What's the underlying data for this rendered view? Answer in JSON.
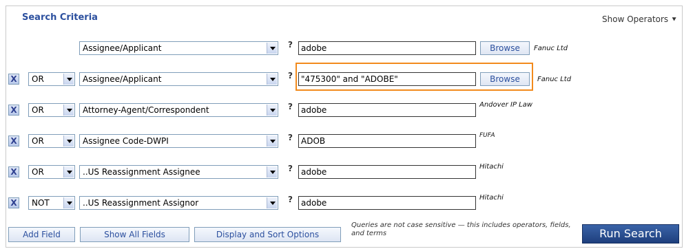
{
  "title": "Search Criteria",
  "show_operators": "Show Operators",
  "rows": [
    {
      "operator": "",
      "field": "Assignee/Applicant",
      "value": "adobe",
      "browse": "Browse",
      "hint": "Fanuc Ltd"
    },
    {
      "operator": "OR",
      "field": "Assignee/Applicant",
      "value": "\"475300\" and \"ADOBE\"",
      "browse": "Browse",
      "hint": "Fanuc Ltd"
    },
    {
      "operator": "OR",
      "field": "Attorney-Agent/Correspondent",
      "value": "adobe",
      "hint": "Andover IP Law"
    },
    {
      "operator": "OR",
      "field": "Assignee Code-DWPI",
      "value": "ADOB",
      "hint": "FUFA"
    },
    {
      "operator": "OR",
      "field": "..US Reassignment Assignee",
      "value": "adobe",
      "hint": "Hitachi"
    },
    {
      "operator": "NOT",
      "field": "..US Reassignment Assignor",
      "value": "adobe",
      "hint": "Hitachi"
    }
  ],
  "remove_glyph": "X",
  "help_glyph": "?",
  "buttons": {
    "add_field": "Add Field",
    "show_all_fields": "Show All Fields",
    "display_sort": "Display and Sort Options",
    "run_search": "Run Search"
  },
  "note": "Queries are not case sensitive — this includes operators, fields, and terms",
  "colors": {
    "title": "#2b4f9e",
    "highlight": "#f28a1c",
    "run_button": "#1e3f7d"
  }
}
